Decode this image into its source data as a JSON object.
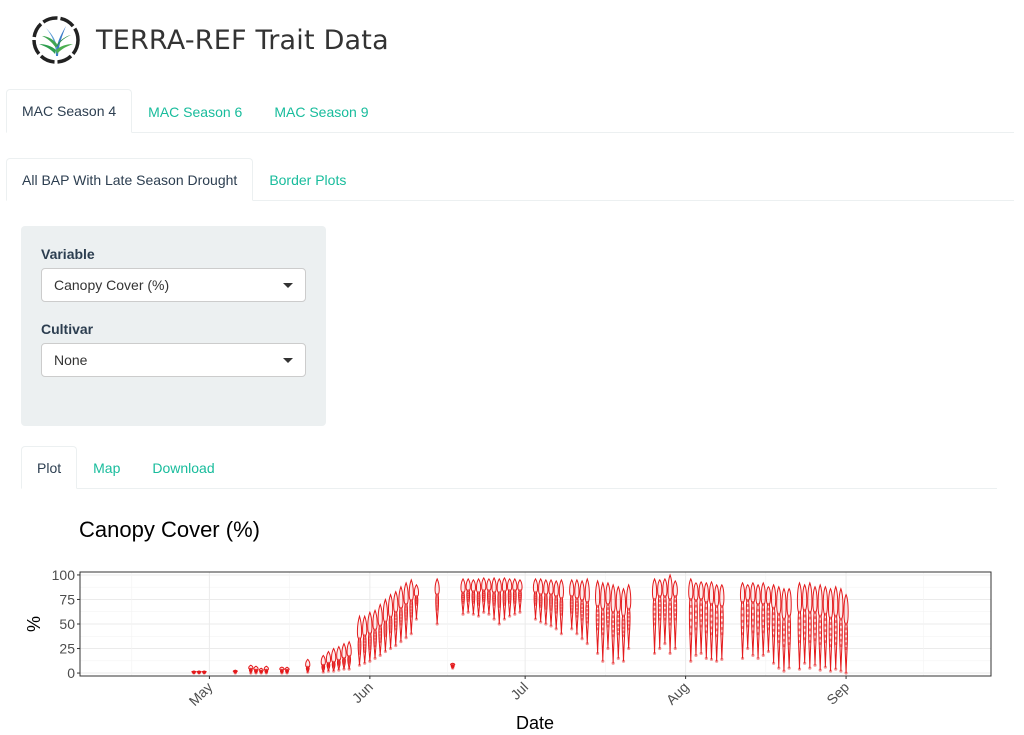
{
  "app": {
    "title": "TERRA-REF Trait Data",
    "logo": "terra-ref-logo"
  },
  "season_tabs": [
    {
      "label": "MAC Season 4",
      "active": true
    },
    {
      "label": "MAC Season 6",
      "active": false
    },
    {
      "label": "MAC Season 9",
      "active": false
    }
  ],
  "experiment_tabs": [
    {
      "label": "All BAP With Late Season Drought",
      "active": true
    },
    {
      "label": "Border Plots",
      "active": false
    }
  ],
  "controls": {
    "variable": {
      "label": "Variable",
      "value": "Canopy Cover (%)",
      "icon": "caret-down-icon"
    },
    "cultivar": {
      "label": "Cultivar",
      "value": "None",
      "icon": "caret-down-icon"
    }
  },
  "output_tabs": [
    {
      "label": "Plot",
      "active": true
    },
    {
      "label": "Map",
      "active": false
    },
    {
      "label": "Download",
      "active": false
    }
  ],
  "colors": {
    "accent": "#18bc9c",
    "text": "#2c3e50",
    "well": "#ecf0f1",
    "series": "#e41a1c"
  },
  "chart_data": {
    "type": "violin",
    "title": "Canopy Cover (%)",
    "xlabel": "Date",
    "ylabel": "%",
    "xlim": [
      "2017-04-06",
      "2017-09-29"
    ],
    "ylim": [
      -3,
      103
    ],
    "yticks": [
      0,
      25,
      50,
      75,
      100
    ],
    "xticks": [
      {
        "date": "2017-05-01",
        "label": "May"
      },
      {
        "date": "2017-06-01",
        "label": "Jun"
      },
      {
        "date": "2017-07-01",
        "label": "Jul"
      },
      {
        "date": "2017-08-01",
        "label": "Aug"
      },
      {
        "date": "2017-09-01",
        "label": "Sep"
      }
    ],
    "grid": true,
    "series_columns": [
      "date",
      "min",
      "q1",
      "median",
      "q3",
      "max"
    ],
    "violins": [
      [
        "2017-04-28",
        0,
        0.5,
        1,
        1.5,
        2
      ],
      [
        "2017-04-29",
        0,
        0.5,
        1,
        1.5,
        2
      ],
      [
        "2017-04-30",
        0,
        0.5,
        1,
        1.5,
        2
      ],
      [
        "2017-05-06",
        0,
        1,
        1.5,
        2,
        3
      ],
      [
        "2017-05-09",
        0,
        2,
        4,
        6,
        8
      ],
      [
        "2017-05-10",
        0,
        1,
        3,
        5,
        7
      ],
      [
        "2017-05-11",
        0,
        1,
        2,
        3,
        5
      ],
      [
        "2017-05-12",
        0,
        1,
        3,
        5,
        7
      ],
      [
        "2017-05-15",
        0,
        1,
        3,
        5,
        6
      ],
      [
        "2017-05-16",
        0,
        1,
        3,
        4,
        6
      ],
      [
        "2017-05-20",
        1,
        3,
        6,
        10,
        14
      ],
      [
        "2017-05-23",
        1,
        4,
        8,
        13,
        18
      ],
      [
        "2017-05-24",
        2,
        6,
        10,
        16,
        22
      ],
      [
        "2017-05-25",
        2,
        6,
        11,
        18,
        25
      ],
      [
        "2017-05-26",
        3,
        8,
        13,
        20,
        27
      ],
      [
        "2017-05-27",
        4,
        9,
        15,
        22,
        30
      ],
      [
        "2017-05-28",
        4,
        10,
        17,
        24,
        32
      ],
      [
        "2017-05-30",
        8,
        20,
        35,
        45,
        58
      ],
      [
        "2017-05-31",
        10,
        22,
        38,
        48,
        58
      ],
      [
        "2017-06-01",
        12,
        25,
        40,
        52,
        62
      ],
      [
        "2017-06-02",
        15,
        28,
        44,
        55,
        64
      ],
      [
        "2017-06-03",
        18,
        32,
        48,
        60,
        70
      ],
      [
        "2017-06-04",
        22,
        38,
        52,
        65,
        75
      ],
      [
        "2017-06-05",
        25,
        42,
        57,
        70,
        80
      ],
      [
        "2017-06-06",
        28,
        45,
        62,
        74,
        83
      ],
      [
        "2017-06-07",
        32,
        50,
        66,
        78,
        88
      ],
      [
        "2017-06-08",
        36,
        55,
        70,
        82,
        92
      ],
      [
        "2017-06-09",
        40,
        58,
        74,
        85,
        95
      ],
      [
        "2017-06-10",
        55,
        70,
        78,
        84,
        90
      ],
      [
        "2017-06-14",
        50,
        65,
        80,
        88,
        96
      ],
      [
        "2017-06-17",
        5,
        6,
        8,
        9,
        10
      ],
      [
        "2017-06-19",
        60,
        72,
        82,
        90,
        96
      ],
      [
        "2017-06-20",
        62,
        74,
        84,
        90,
        96
      ],
      [
        "2017-06-21",
        60,
        72,
        83,
        90,
        95
      ],
      [
        "2017-06-22",
        58,
        70,
        82,
        90,
        96
      ],
      [
        "2017-06-23",
        62,
        74,
        84,
        91,
        97
      ],
      [
        "2017-06-24",
        60,
        72,
        84,
        91,
        96
      ],
      [
        "2017-06-25",
        55,
        70,
        82,
        90,
        97
      ],
      [
        "2017-06-26",
        50,
        68,
        82,
        90,
        96
      ],
      [
        "2017-06-27",
        55,
        70,
        83,
        91,
        97
      ],
      [
        "2017-06-28",
        58,
        72,
        84,
        91,
        96
      ],
      [
        "2017-06-29",
        60,
        72,
        84,
        90,
        96
      ],
      [
        "2017-06-30",
        62,
        74,
        84,
        90,
        95
      ],
      [
        "2017-07-03",
        55,
        70,
        82,
        90,
        96
      ],
      [
        "2017-07-04",
        52,
        68,
        80,
        90,
        96
      ],
      [
        "2017-07-05",
        50,
        66,
        80,
        89,
        95
      ],
      [
        "2017-07-06",
        48,
        65,
        80,
        89,
        95
      ],
      [
        "2017-07-07",
        45,
        62,
        78,
        88,
        94
      ],
      [
        "2017-07-08",
        40,
        60,
        76,
        88,
        95
      ],
      [
        "2017-07-10",
        45,
        62,
        78,
        88,
        95
      ],
      [
        "2017-07-11",
        40,
        58,
        76,
        88,
        95
      ],
      [
        "2017-07-12",
        35,
        55,
        74,
        87,
        94
      ],
      [
        "2017-07-13",
        30,
        52,
        72,
        86,
        96
      ],
      [
        "2017-07-15",
        20,
        45,
        68,
        84,
        94
      ],
      [
        "2017-07-16",
        12,
        40,
        65,
        82,
        92
      ],
      [
        "2017-07-17",
        25,
        48,
        70,
        84,
        92
      ],
      [
        "2017-07-18",
        10,
        38,
        62,
        80,
        90
      ],
      [
        "2017-07-19",
        15,
        40,
        62,
        80,
        88
      ],
      [
        "2017-07-20",
        12,
        38,
        58,
        78,
        86
      ],
      [
        "2017-07-21",
        25,
        45,
        65,
        80,
        90
      ],
      [
        "2017-07-26",
        20,
        50,
        75,
        88,
        96
      ],
      [
        "2017-07-27",
        25,
        55,
        78,
        90,
        95
      ],
      [
        "2017-07-28",
        30,
        55,
        78,
        90,
        96
      ],
      [
        "2017-07-29",
        20,
        50,
        75,
        90,
        100
      ],
      [
        "2017-07-30",
        25,
        55,
        78,
        88,
        94
      ],
      [
        "2017-08-02",
        12,
        40,
        75,
        88,
        96
      ],
      [
        "2017-08-03",
        18,
        45,
        74,
        88,
        92
      ],
      [
        "2017-08-04",
        20,
        48,
        75,
        88,
        93
      ],
      [
        "2017-08-05",
        15,
        42,
        72,
        86,
        92
      ],
      [
        "2017-08-06",
        14,
        40,
        70,
        86,
        93
      ],
      [
        "2017-08-07",
        12,
        38,
        68,
        84,
        90
      ],
      [
        "2017-08-08",
        14,
        40,
        68,
        84,
        90
      ],
      [
        "2017-08-12",
        15,
        40,
        72,
        85,
        92
      ],
      [
        "2017-08-13",
        25,
        48,
        74,
        86,
        90
      ],
      [
        "2017-08-14",
        18,
        42,
        72,
        86,
        92
      ],
      [
        "2017-08-15",
        15,
        40,
        70,
        84,
        90
      ],
      [
        "2017-08-16",
        18,
        42,
        70,
        84,
        92
      ],
      [
        "2017-08-17",
        22,
        45,
        70,
        84,
        88
      ],
      [
        "2017-08-18",
        10,
        38,
        66,
        82,
        90
      ],
      [
        "2017-08-19",
        5,
        32,
        60,
        80,
        88
      ],
      [
        "2017-08-20",
        2,
        28,
        55,
        78,
        86
      ],
      [
        "2017-08-21",
        5,
        30,
        58,
        80,
        86
      ],
      [
        "2017-08-23",
        4,
        32,
        62,
        82,
        92
      ],
      [
        "2017-08-24",
        10,
        35,
        64,
        82,
        90
      ],
      [
        "2017-08-25",
        5,
        32,
        62,
        82,
        92
      ],
      [
        "2017-08-26",
        8,
        34,
        62,
        80,
        88
      ],
      [
        "2017-08-27",
        3,
        30,
        58,
        80,
        90
      ],
      [
        "2017-08-28",
        6,
        32,
        60,
        80,
        88
      ],
      [
        "2017-08-29",
        2,
        28,
        56,
        78,
        86
      ],
      [
        "2017-08-30",
        4,
        30,
        58,
        78,
        88
      ],
      [
        "2017-08-31",
        2,
        28,
        55,
        76,
        86
      ],
      [
        "2017-09-01",
        0,
        25,
        50,
        72,
        80
      ]
    ]
  }
}
